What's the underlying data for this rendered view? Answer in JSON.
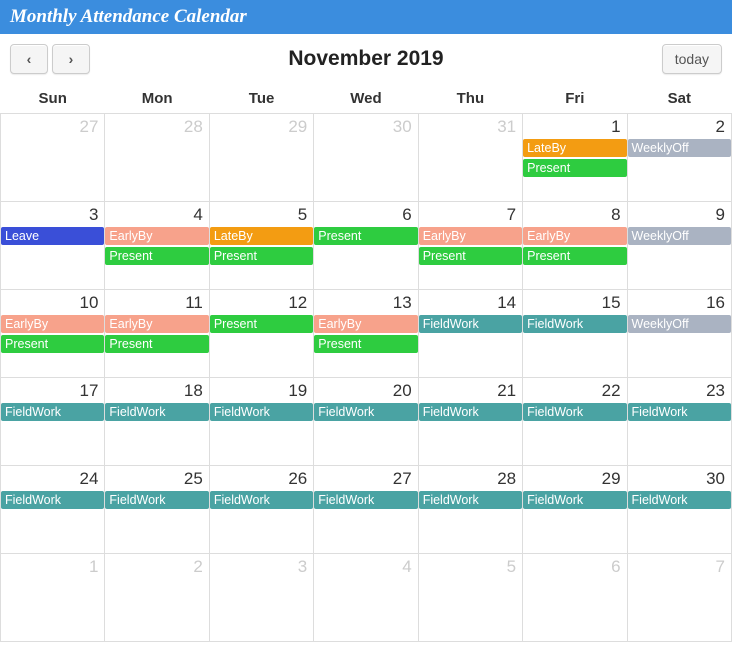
{
  "header": {
    "title": "Monthly Attendance Calendar"
  },
  "toolbar": {
    "prev_icon": "‹",
    "next_icon": "›",
    "today_label": "today",
    "month_title": "November 2019"
  },
  "weekdays": [
    "Sun",
    "Mon",
    "Tue",
    "Wed",
    "Thu",
    "Fri",
    "Sat"
  ],
  "event_colors": {
    "LateBy": "#f39c12",
    "Present": "#2ecc40",
    "WeeklyOff": "#aab3c2",
    "Leave": "#3a4fd8",
    "EarlyBy": "#f7a28b",
    "FieldWork": "#4aa3a3"
  },
  "weeks": [
    [
      {
        "day": 27,
        "other": true,
        "events": []
      },
      {
        "day": 28,
        "other": true,
        "events": []
      },
      {
        "day": 29,
        "other": true,
        "events": []
      },
      {
        "day": 30,
        "other": true,
        "events": []
      },
      {
        "day": 31,
        "other": true,
        "events": []
      },
      {
        "day": 1,
        "other": false,
        "events": [
          "LateBy",
          "Present"
        ]
      },
      {
        "day": 2,
        "other": false,
        "events": [
          "WeeklyOff"
        ]
      }
    ],
    [
      {
        "day": 3,
        "other": false,
        "events": [
          "Leave"
        ]
      },
      {
        "day": 4,
        "other": false,
        "events": [
          "EarlyBy",
          "Present"
        ]
      },
      {
        "day": 5,
        "other": false,
        "events": [
          "LateBy",
          "Present"
        ]
      },
      {
        "day": 6,
        "other": false,
        "events": [
          "Present"
        ]
      },
      {
        "day": 7,
        "other": false,
        "events": [
          "EarlyBy",
          "Present"
        ]
      },
      {
        "day": 8,
        "other": false,
        "events": [
          "EarlyBy",
          "Present"
        ]
      },
      {
        "day": 9,
        "other": false,
        "events": [
          "WeeklyOff"
        ]
      }
    ],
    [
      {
        "day": 10,
        "other": false,
        "events": [
          "EarlyBy",
          "Present"
        ]
      },
      {
        "day": 11,
        "other": false,
        "events": [
          "EarlyBy",
          "Present"
        ]
      },
      {
        "day": 12,
        "other": false,
        "events": [
          "Present"
        ]
      },
      {
        "day": 13,
        "other": false,
        "events": [
          "EarlyBy",
          "Present"
        ]
      },
      {
        "day": 14,
        "other": false,
        "events": [
          "FieldWork"
        ]
      },
      {
        "day": 15,
        "other": false,
        "events": [
          "FieldWork"
        ]
      },
      {
        "day": 16,
        "other": false,
        "events": [
          "WeeklyOff"
        ]
      }
    ],
    [
      {
        "day": 17,
        "other": false,
        "events": [
          "FieldWork"
        ]
      },
      {
        "day": 18,
        "other": false,
        "events": [
          "FieldWork"
        ]
      },
      {
        "day": 19,
        "other": false,
        "events": [
          "FieldWork"
        ]
      },
      {
        "day": 20,
        "other": false,
        "events": [
          "FieldWork"
        ]
      },
      {
        "day": 21,
        "other": false,
        "events": [
          "FieldWork"
        ]
      },
      {
        "day": 22,
        "other": false,
        "events": [
          "FieldWork"
        ]
      },
      {
        "day": 23,
        "other": false,
        "events": [
          "FieldWork"
        ]
      }
    ],
    [
      {
        "day": 24,
        "other": false,
        "events": [
          "FieldWork"
        ]
      },
      {
        "day": 25,
        "other": false,
        "events": [
          "FieldWork"
        ]
      },
      {
        "day": 26,
        "other": false,
        "events": [
          "FieldWork"
        ]
      },
      {
        "day": 27,
        "other": false,
        "events": [
          "FieldWork"
        ]
      },
      {
        "day": 28,
        "other": false,
        "events": [
          "FieldWork"
        ]
      },
      {
        "day": 29,
        "other": false,
        "events": [
          "FieldWork"
        ]
      },
      {
        "day": 30,
        "other": false,
        "events": [
          "FieldWork"
        ]
      }
    ],
    [
      {
        "day": 1,
        "other": true,
        "events": []
      },
      {
        "day": 2,
        "other": true,
        "events": []
      },
      {
        "day": 3,
        "other": true,
        "events": []
      },
      {
        "day": 4,
        "other": true,
        "events": []
      },
      {
        "day": 5,
        "other": true,
        "events": []
      },
      {
        "day": 6,
        "other": true,
        "events": []
      },
      {
        "day": 7,
        "other": true,
        "events": []
      }
    ]
  ]
}
